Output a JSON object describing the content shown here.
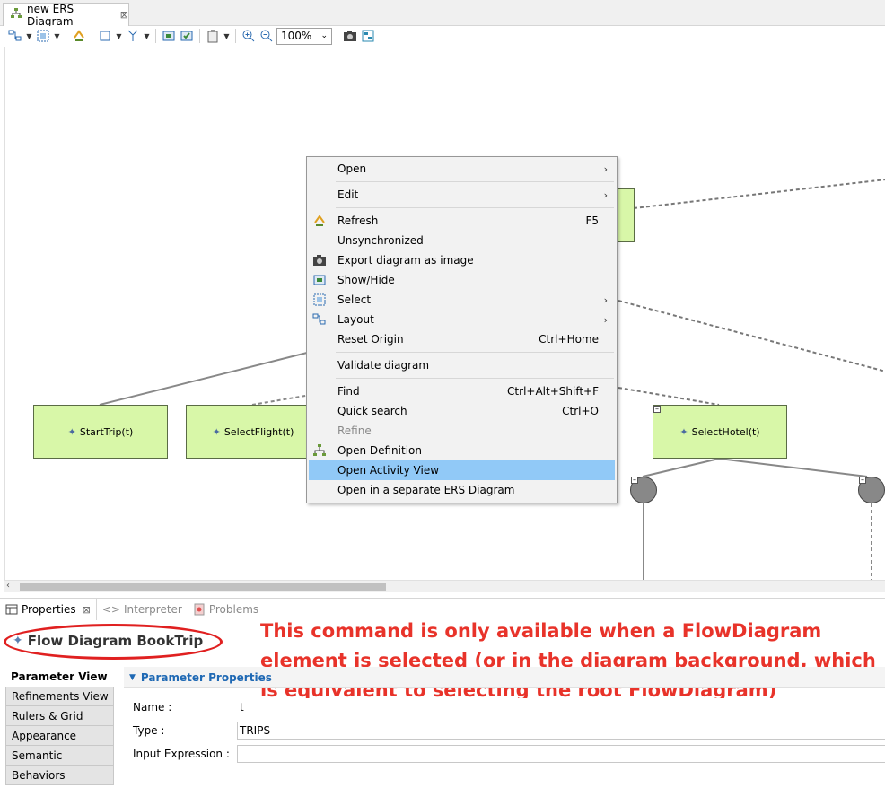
{
  "editor_tab": {
    "title": "new ERS Diagram",
    "close": "⊠"
  },
  "toolbar": {
    "zoom_value": "100%"
  },
  "diagram": {
    "nodes": {
      "start_trip": "StartTrip(t)",
      "select_flight": "SelectFlight(t)",
      "select_hotel": "SelectHotel(t)"
    }
  },
  "context_menu": {
    "items": [
      {
        "label": "Open",
        "submenu": true
      },
      {
        "label": "Edit",
        "submenu": true
      },
      {
        "label": "Refresh",
        "accel": "F5",
        "icon": "refresh-icon"
      },
      {
        "label": "Unsynchronized"
      },
      {
        "label": "Export diagram as image",
        "icon": "camera-icon"
      },
      {
        "label": "Show/Hide",
        "icon": "show-hide-icon"
      },
      {
        "label": "Select",
        "submenu": true,
        "icon": "select-icon"
      },
      {
        "label": "Layout",
        "submenu": true,
        "icon": "layout-icon"
      },
      {
        "label": "Reset Origin",
        "accel": "Ctrl+Home"
      },
      {
        "label": "Validate diagram"
      },
      {
        "label": "Find",
        "accel": "Ctrl+Alt+Shift+F"
      },
      {
        "label": "Quick search",
        "accel": "Ctrl+O"
      },
      {
        "label": "Refine",
        "disabled": true
      },
      {
        "label": "Open Definition",
        "icon": "diagram-icon"
      },
      {
        "label": "Open Activity View",
        "highlighted": true
      },
      {
        "label": "Open in a separate ERS Diagram"
      }
    ],
    "submenu_arrow": "›"
  },
  "bottom_panel": {
    "tabs": [
      {
        "label": "Properties",
        "active": true
      },
      {
        "label": "Interpreter",
        "active": false
      },
      {
        "label": "Problems",
        "active": false
      }
    ],
    "title": "Flow Diagram BookTrip",
    "vertical_tabs": [
      "Parameter View",
      "Refinements View",
      "Rulers & Grid",
      "Appearance",
      "Semantic",
      "Behaviors"
    ],
    "section_title": "Parameter Properties",
    "fields": {
      "name": {
        "label": "Name :",
        "value": "t"
      },
      "type": {
        "label": "Type :",
        "value": "TRIPS"
      },
      "input_expression": {
        "label": "Input Expression :",
        "value": ""
      }
    }
  },
  "annotation": {
    "text": "This command is only available when a FlowDiagram element is selected (or in the diagram background, which is equivalent to selecting the root FlowDiagram)",
    "color": "#e8332a"
  }
}
